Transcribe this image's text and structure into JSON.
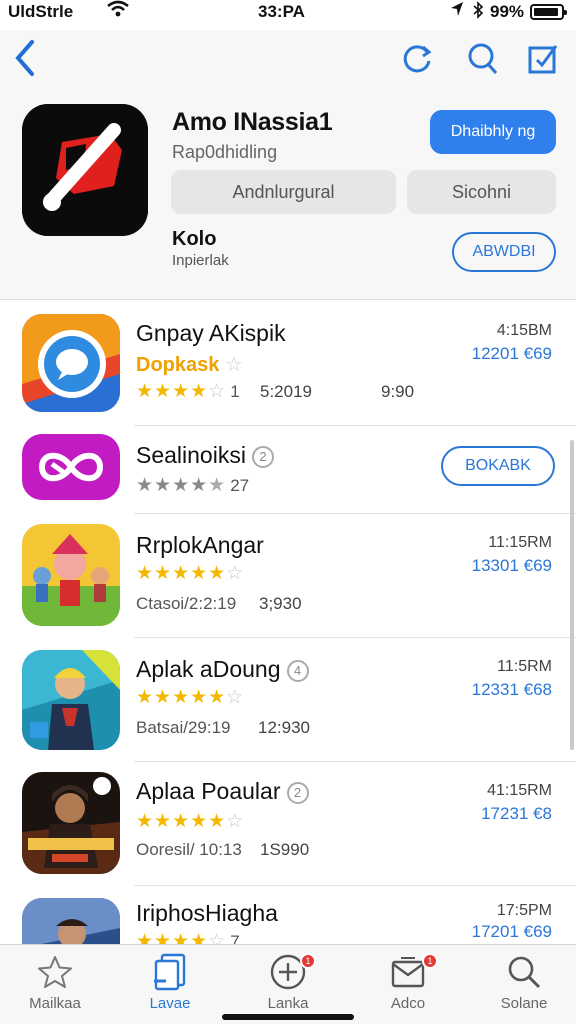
{
  "status": {
    "carrier": "UldStrle",
    "time": "33:PA",
    "battery_pct": "99%"
  },
  "nav": {
    "back_icon": "chevron-left-icon",
    "refresh_icon": "refresh-icon",
    "search_icon": "search-icon",
    "edit_icon": "edit-icon"
  },
  "hero": {
    "title": "Amo INassia1",
    "subtitle": "Rap0dhidling",
    "primary_button": "Dhaibhly ng",
    "pill_left": "Andnlurgural",
    "pill_right": "Sicohni",
    "label": "Kolo",
    "sublabel": "Inpierlak",
    "outline_button": "ABWDBI"
  },
  "apps": [
    {
      "title": "Gnpay AKispik",
      "category": "Dopkask",
      "stars": 4,
      "star_count": "1",
      "meta_a": "5:2019",
      "meta_b": "9:90",
      "time": "4:15BM",
      "price": "12201 €69"
    },
    {
      "title": "Sealinoiksi",
      "badge": "2",
      "stars": 4,
      "star_count": "27",
      "button": "BOKABK"
    },
    {
      "title": "RrplokAngar",
      "stars": 4,
      "meta": "Ctasoi/2:2:19",
      "meta_b": "3;930",
      "time": "11:15RM",
      "price": "13301 €69"
    },
    {
      "title": "Aplak aDoung",
      "badge": "4",
      "stars": 4,
      "meta": "Batsai/29:19",
      "meta_b": "12:930",
      "time": "11:5RM",
      "price": "12331 €68"
    },
    {
      "title": "Aplaa Poaular",
      "badge": "2",
      "stars": 4,
      "meta": "Ooresil/ 10:13",
      "meta_b": "1S990",
      "time": "41:15RM",
      "price": "17231 €8"
    },
    {
      "title": "IriphosHiagha",
      "stars": 4,
      "star_count": "7",
      "time": "17:5PM",
      "price": "17201 €69"
    }
  ],
  "tabs": [
    {
      "label": "Mailkaa",
      "icon": "star-icon"
    },
    {
      "label": "Lavae",
      "icon": "documents-icon"
    },
    {
      "label": "Lanka",
      "icon": "add-circle-icon",
      "badge": "1"
    },
    {
      "label": "Adco",
      "icon": "mail-icon",
      "badge": "1"
    },
    {
      "label": "Solane",
      "icon": "search-icon"
    }
  ],
  "colors": {
    "accent": "#2b77d8",
    "primary_button": "#2f80ed",
    "star": "#f5b800",
    "badge": "#e53935"
  }
}
